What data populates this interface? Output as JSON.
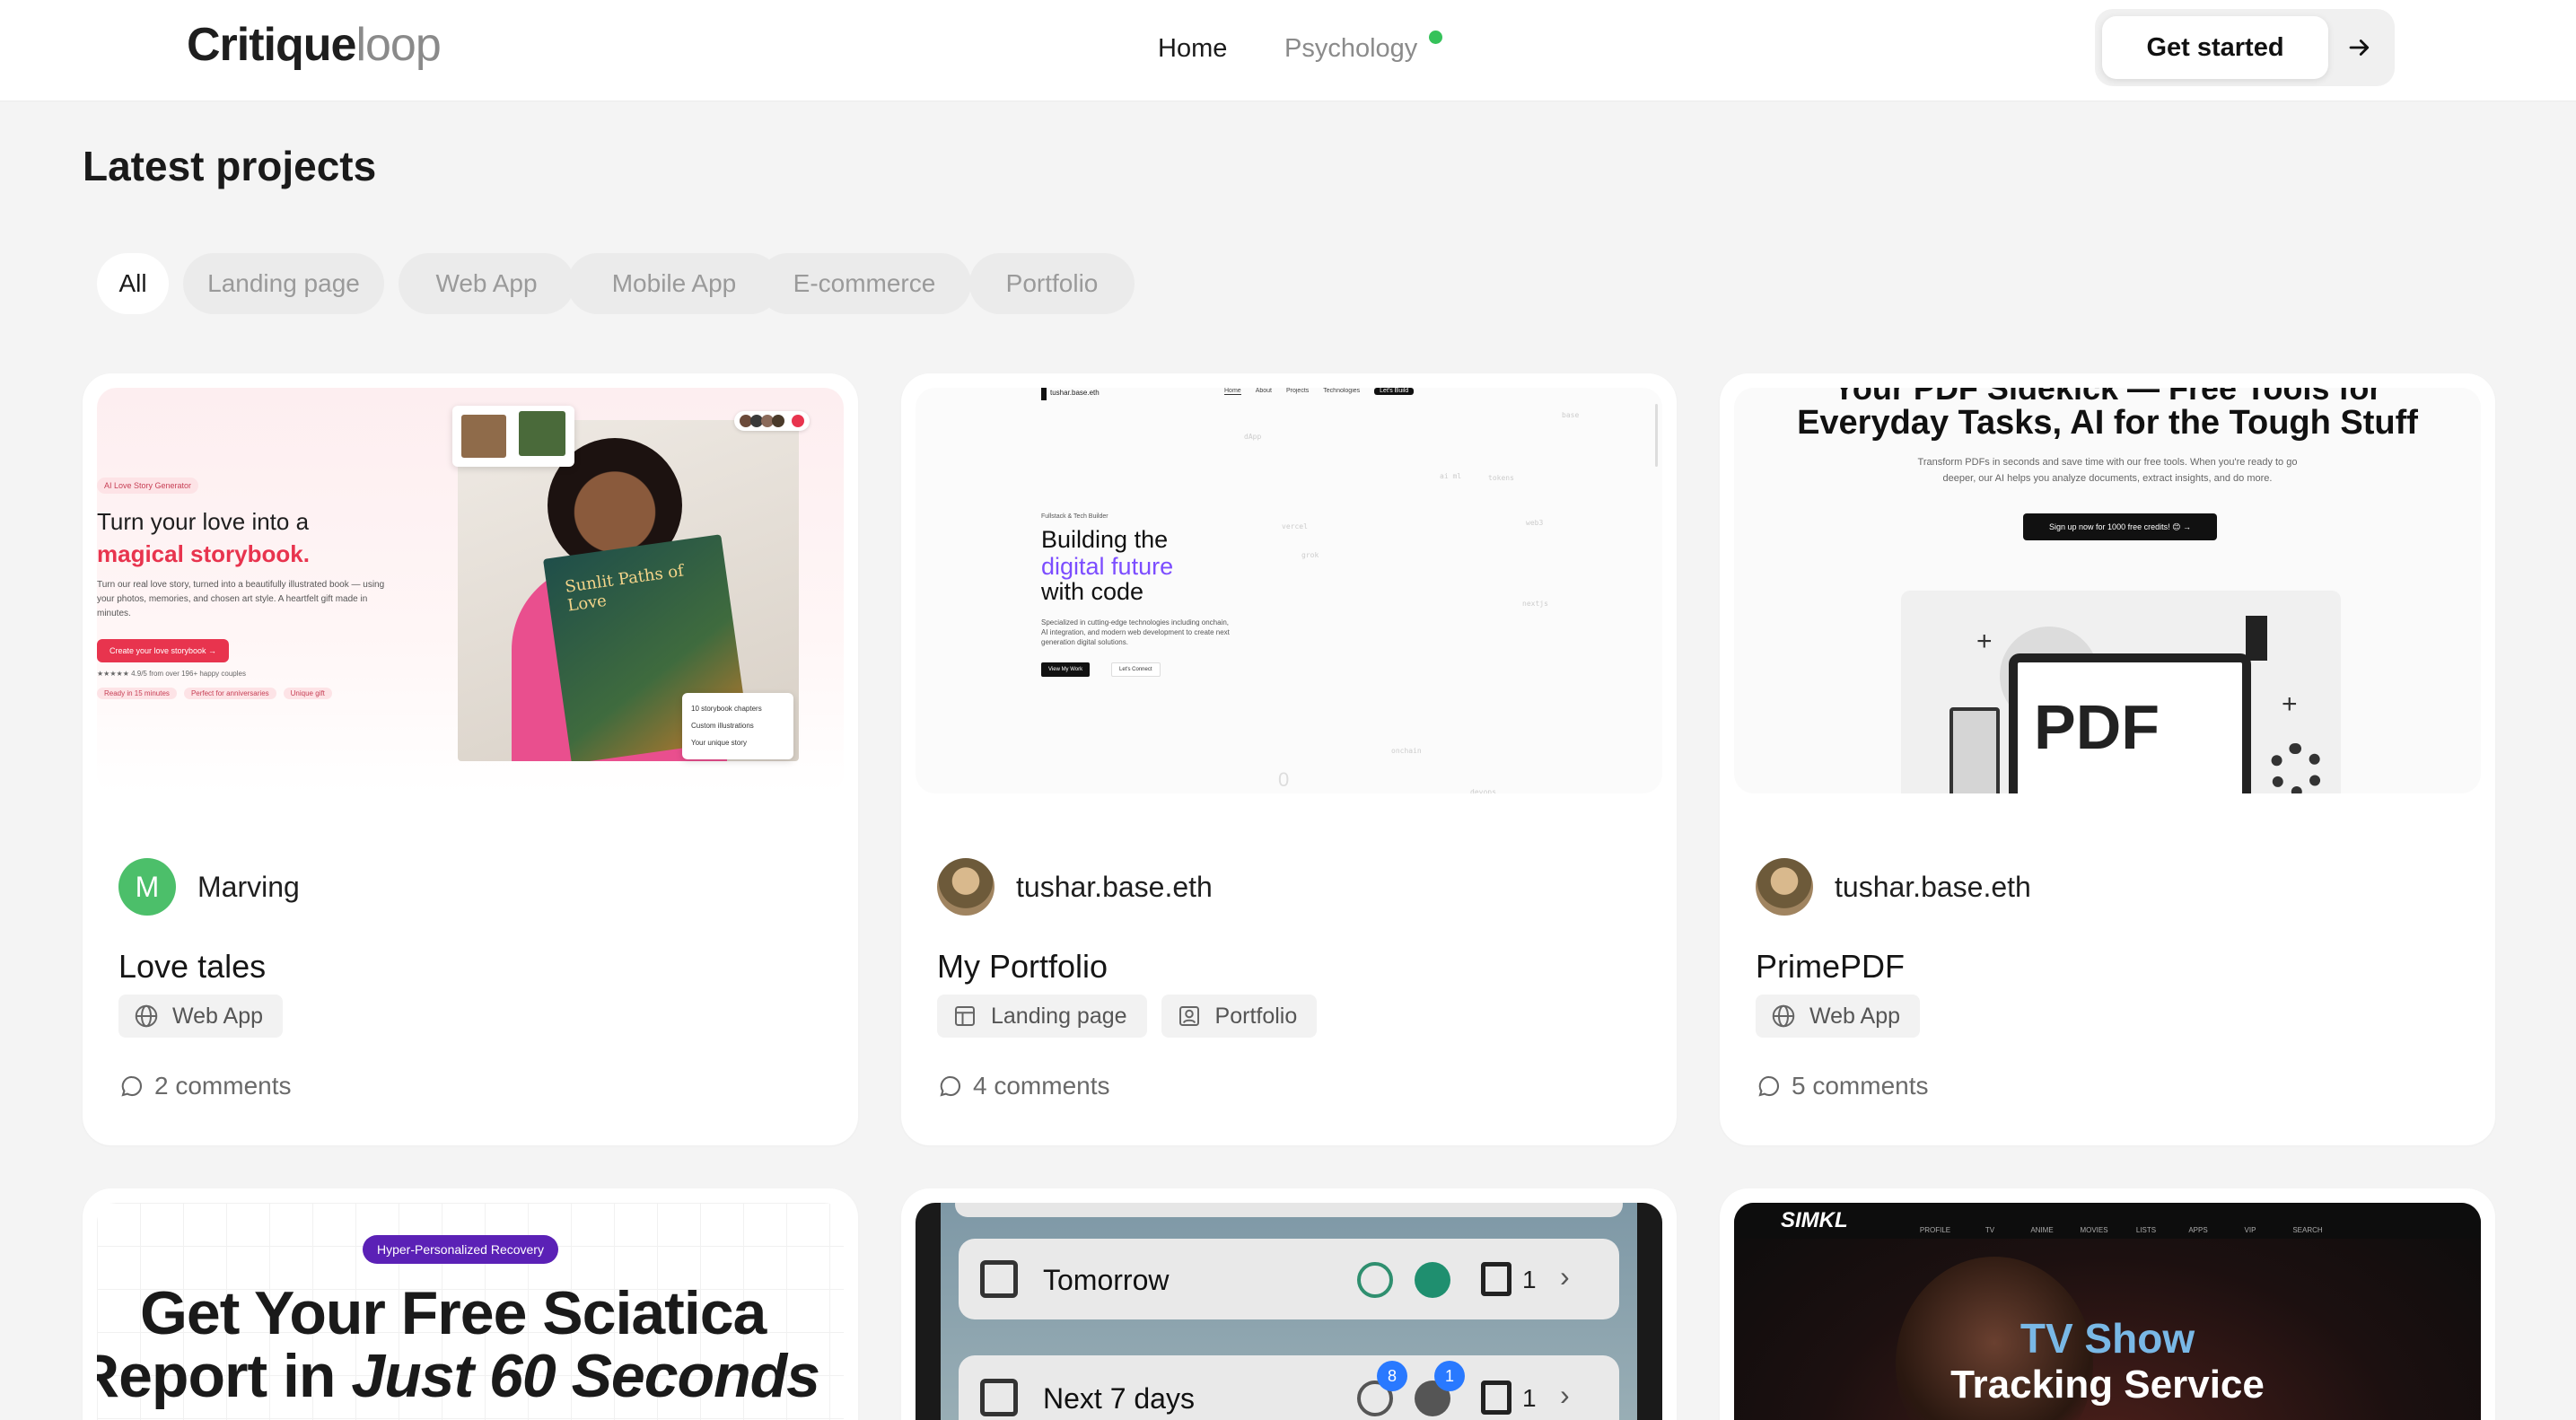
{
  "header": {
    "logo_main": "Critique",
    "logo_accent": "loop",
    "nav": {
      "home": "Home",
      "psychology": "Psychology"
    },
    "cta": "Get started"
  },
  "section": {
    "title": "Latest projects"
  },
  "filters": [
    "All",
    "Landing page",
    "Web App",
    "Mobile App",
    "E-commerce",
    "Portfolio"
  ],
  "projects": [
    {
      "author": "Marving",
      "avatar_letter": "M",
      "title": "Love tales",
      "tags": [
        "Web App"
      ],
      "comments": "2 comments",
      "thumb": {
        "badge": "AI Love Story Generator",
        "headline1": "Turn your love into a",
        "headline2": "magical storybook.",
        "body": "Turn our real love story, turned into a beautifully illustrated book — using your photos, memories, and chosen art style. A heartfelt gift made in minutes.",
        "button": "Create your love storybook →",
        "rating": "★★★★★ 4.9/5 from over 196+ happy couples",
        "pills": [
          "Ready in 15 minutes",
          "Perfect for anniversaries",
          "Unique gift"
        ],
        "book_title": "Sunlit Paths of Love",
        "list": [
          "10 storybook chapters",
          "Custom illustrations",
          "Your unique story"
        ]
      }
    },
    {
      "author": "tushar.base.eth",
      "title": "My Portfolio",
      "tags": [
        "Landing page",
        "Portfolio"
      ],
      "comments": "4 comments",
      "thumb": {
        "brand": "tushar.base.eth",
        "nav": [
          "Home",
          "About",
          "Projects",
          "Technologies",
          "Let's Build"
        ],
        "kicker": "Fullstack & Tech Builder",
        "h1": "Building the",
        "h2": "digital future",
        "h3": "with code",
        "body": "Specialized in cutting-edge technologies including onchain, AI integration, and modern web development to create next generation digital solutions.",
        "btn1": "View My Work",
        "btn2": "Let's Connect",
        "words": [
          "dApp",
          "ai ml",
          "tokens",
          "vercel",
          "grok",
          "nextjs",
          "web3",
          "onchain",
          "devops",
          "base",
          "0"
        ]
      }
    },
    {
      "author": "tushar.base.eth",
      "title": "PrimePDF",
      "tags": [
        "Web App"
      ],
      "comments": "5 comments",
      "thumb": {
        "top": "Your PDF Sidekick — Free Tools for",
        "headline": "Everyday Tasks, AI for the Tough Stuff",
        "body": "Transform PDFs in seconds and save time with our free tools. When you're ready to go deeper, our AI helps you analyze documents, extract insights, and do more.",
        "button": "Sign up now for 1000 free credits! 😊 →",
        "pdf": "PDF"
      }
    }
  ],
  "bottom": {
    "sciatica": {
      "pill": "Hyper-Personalized Recovery",
      "line1": "Get Your Free Sciatica",
      "line2a": "Report in ",
      "line2b": "Just 60 Seconds"
    },
    "tasks": {
      "row1": "Tomorrow",
      "row1_count": "1",
      "row2": "Next 7 days",
      "row2_count": "1",
      "badge1": "8",
      "badge2": "1"
    },
    "simkl": {
      "brand": "SIMKL",
      "nav": [
        "PROFILE",
        "TV",
        "ANIME",
        "MOVIES",
        "LISTS",
        "APPS",
        "VIP",
        "SEARCH"
      ],
      "line1": "TV Show",
      "line2": "Tracking Service"
    }
  },
  "colors": {
    "accent_red": "#e8344e",
    "accent_purple": "#7c4dff",
    "green_dot": "#35c25a"
  }
}
